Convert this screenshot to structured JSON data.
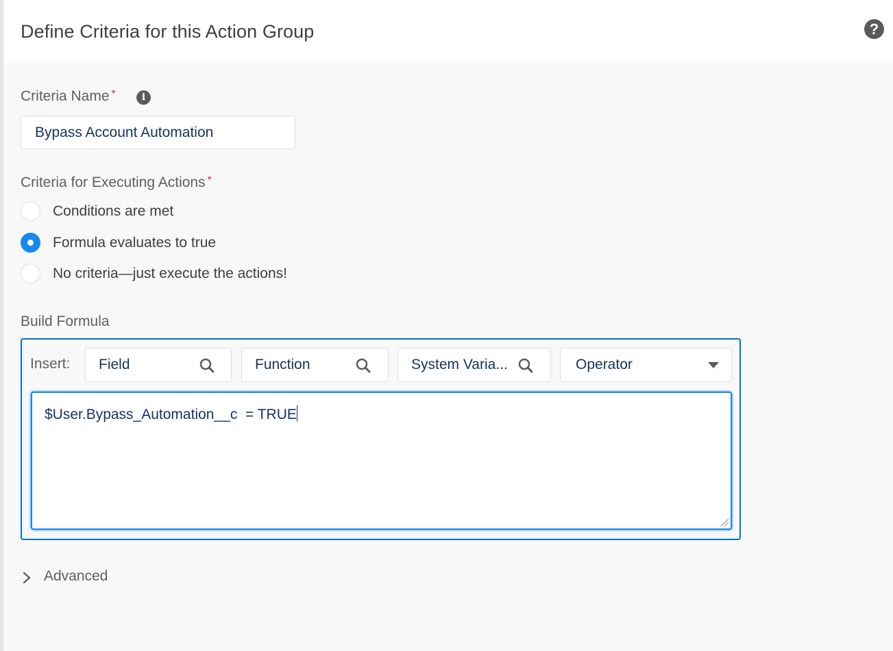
{
  "header": {
    "title": "Define Criteria for this Action Group",
    "help_icon": "question-circle-icon"
  },
  "criteria_name": {
    "label": "Criteria Name",
    "required_marker": "*",
    "info_icon": "info-icon",
    "value": "Bypass Account Automation"
  },
  "criteria_execution": {
    "label": "Criteria for Executing Actions",
    "required_marker": "*",
    "options": [
      {
        "label": "Conditions are met",
        "checked": false
      },
      {
        "label": "Formula evaluates to true",
        "checked": true
      },
      {
        "label": "No criteria—just execute the actions!",
        "checked": false
      }
    ]
  },
  "build_formula": {
    "label": "Build Formula",
    "insert_label": "Insert:",
    "field_picker": "Field",
    "function_picker": "Function",
    "system_variable_picker": "System Varia...",
    "operator_picker": "Operator",
    "formula": "$User.Bypass_Automation__c  = TRUE"
  },
  "advanced": {
    "label": "Advanced"
  },
  "colors": {
    "accent": "#0070d2",
    "radio_checked": "#1589ee",
    "required": "#c23934"
  }
}
